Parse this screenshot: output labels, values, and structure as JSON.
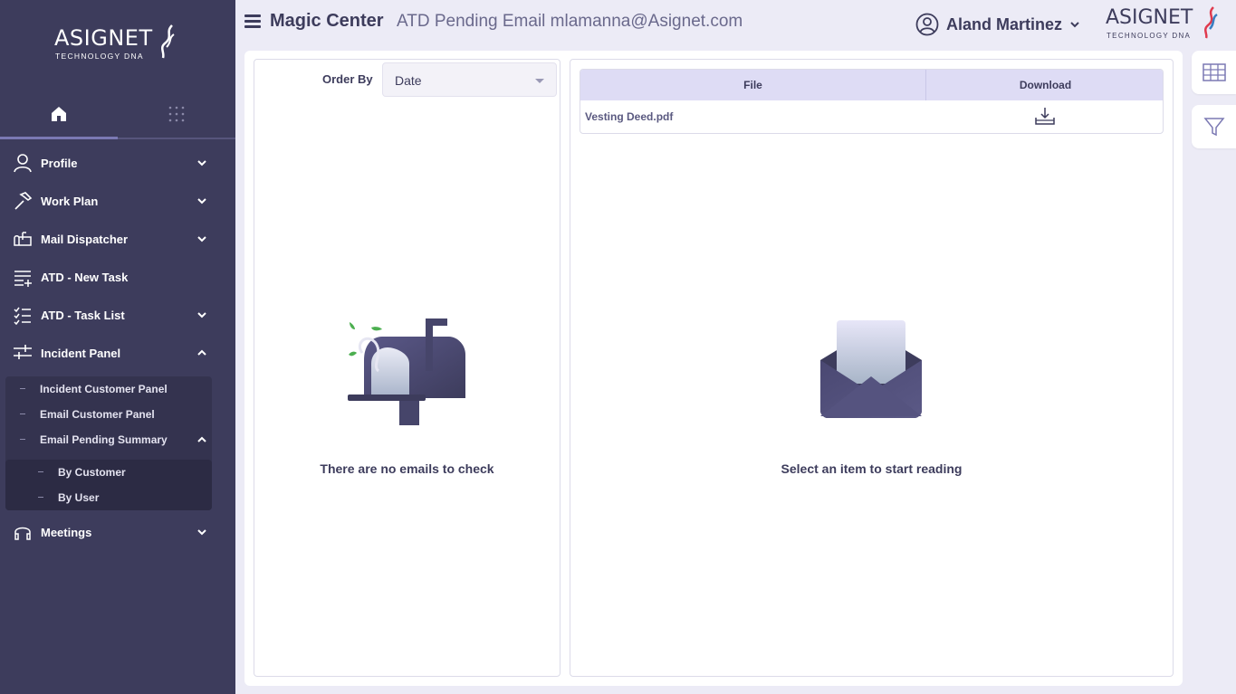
{
  "sidebar": {
    "logo": {
      "word": "ASIGNET",
      "sub": "TECHNOLOGY DNA"
    },
    "tabs": [
      {
        "name": "home-tab"
      },
      {
        "name": "apps-tab"
      }
    ],
    "nav": [
      {
        "label": "Profile",
        "icon": "user-icon",
        "expanded": false
      },
      {
        "label": "Work Plan",
        "icon": "hammer-icon",
        "expanded": false
      },
      {
        "label": "Mail Dispatcher",
        "icon": "mailbox-icon",
        "expanded": false
      },
      {
        "label": "ATD - New Task",
        "icon": "list-add-icon",
        "expanded": false
      },
      {
        "label": "ATD - Task List",
        "icon": "checklist-icon",
        "expanded": false
      },
      {
        "label": "Incident Panel",
        "icon": "sliders-icon",
        "expanded": true
      },
      {
        "label": "Meetings",
        "icon": "headset-icon",
        "expanded": false
      }
    ],
    "incident_sub": [
      {
        "label": "Incident Customer Panel"
      },
      {
        "label": "Email Customer Panel"
      },
      {
        "label": "Email Pending Summary"
      }
    ],
    "pending_sub": [
      {
        "label": "By Customer"
      },
      {
        "label": "By User"
      }
    ]
  },
  "header": {
    "title": "Magic Center",
    "subtitle": "ATD Pending Email mlamanna@Asignet.com",
    "user_name": "Aland Martinez",
    "brand": {
      "word": "ASIGNET",
      "sub": "TECHNOLOGY DNA"
    }
  },
  "left_panel": {
    "order_by_label": "Order By",
    "order_by_value": "Date",
    "empty_message": "There are no emails to check"
  },
  "right_panel": {
    "columns": {
      "file": "File",
      "download": "Download"
    },
    "files": [
      {
        "name": "Vesting Deed.pdf"
      }
    ],
    "empty_message": "Select an item to start reading"
  },
  "colors": {
    "sidebar_bg": "#3d3c5c",
    "page_bg": "#ecebf6",
    "table_header": "#dedcf5",
    "accent": "#7b79b3"
  }
}
